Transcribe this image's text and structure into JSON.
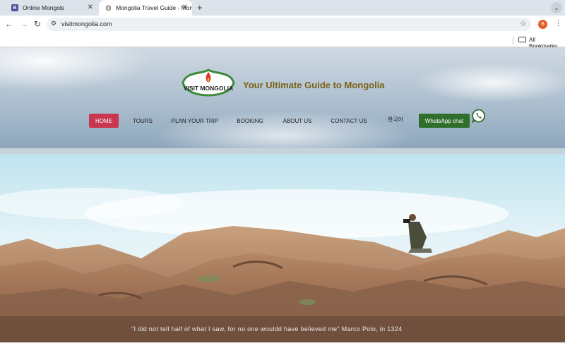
{
  "browser": {
    "tabs": [
      {
        "title": "Online Mongols",
        "favicon": "B"
      },
      {
        "title": "Mongolia Travel Guide - Mongo"
      }
    ],
    "address": "visitmongolia.com",
    "profile_initial": "B",
    "bookmarks_label": "All Bookmarks"
  },
  "site": {
    "logo_text": "VISIT MONGOLIA",
    "tagline": "Your Ultimate Guide to Mongolia",
    "nav": [
      {
        "label": "HOME"
      },
      {
        "label": "TOURS"
      },
      {
        "label": "PLAN YOUR TRIP"
      },
      {
        "label": "BOOKING"
      },
      {
        "label": "ABOUT US"
      },
      {
        "label": "CONTACT US"
      },
      {
        "label": "한국어"
      },
      {
        "label": "WhatsApp chat"
      }
    ],
    "quote": "\"I did not tell half of what I saw, for no one wouldd have believed me\" Marco Polo, in 1324"
  },
  "colors": {
    "home_button": "#c8374f",
    "whatsapp_button": "#2f6e2b",
    "tagline": "#7a6216"
  }
}
